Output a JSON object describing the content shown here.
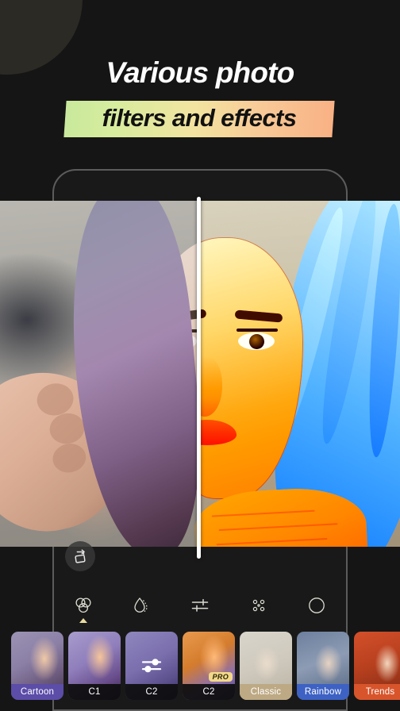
{
  "meta": {
    "background_color": "#151515",
    "accent_gradient_from": "#c9e99c",
    "accent_gradient_to": "#f9b184",
    "selected_label_color": "#5b4da8",
    "pro_badge_color": "#f2d98a"
  },
  "promo": {
    "headline_line1": "Various photo",
    "headline_line2": "filters and effects"
  },
  "editor": {
    "compare_divider": "before-after-slider",
    "rotate_button_label": "Rotate",
    "toolbar": [
      {
        "id": "filters",
        "icon": "three-circles-icon",
        "active": true
      },
      {
        "id": "blur",
        "icon": "droplet-icon",
        "active": false
      },
      {
        "id": "adjust",
        "icon": "sliders-icon",
        "active": false
      },
      {
        "id": "effects",
        "icon": "dots-grid-icon",
        "active": false
      },
      {
        "id": "vignette",
        "icon": "circle-icon",
        "active": false
      }
    ]
  },
  "filter_strip": {
    "items": [
      {
        "label": "Cartoon",
        "art": "art-cartoon",
        "selected": true,
        "pro": false,
        "overlay_icon": null,
        "label_style": "name-sel-purple"
      },
      {
        "label": "C1",
        "art": "art-c1",
        "selected": false,
        "pro": false,
        "overlay_icon": null,
        "label_style": ""
      },
      {
        "label": "C2",
        "art": "art-c2a",
        "selected": false,
        "pro": false,
        "overlay_icon": "sliders-icon",
        "label_style": ""
      },
      {
        "label": "C2",
        "art": "art-c2b",
        "selected": false,
        "pro": true,
        "overlay_icon": null,
        "label_style": ""
      },
      {
        "label": "Classic",
        "art": "art-classic",
        "selected": false,
        "pro": false,
        "overlay_icon": null,
        "label_style": "name-tan"
      },
      {
        "label": "Rainbow",
        "art": "art-rainbow",
        "selected": false,
        "pro": false,
        "overlay_icon": null,
        "label_style": "name-blue"
      },
      {
        "label": "Trends",
        "art": "art-trends",
        "selected": false,
        "pro": false,
        "overlay_icon": null,
        "label_style": "name-orange"
      }
    ],
    "pro_badge_text": "PRO"
  }
}
